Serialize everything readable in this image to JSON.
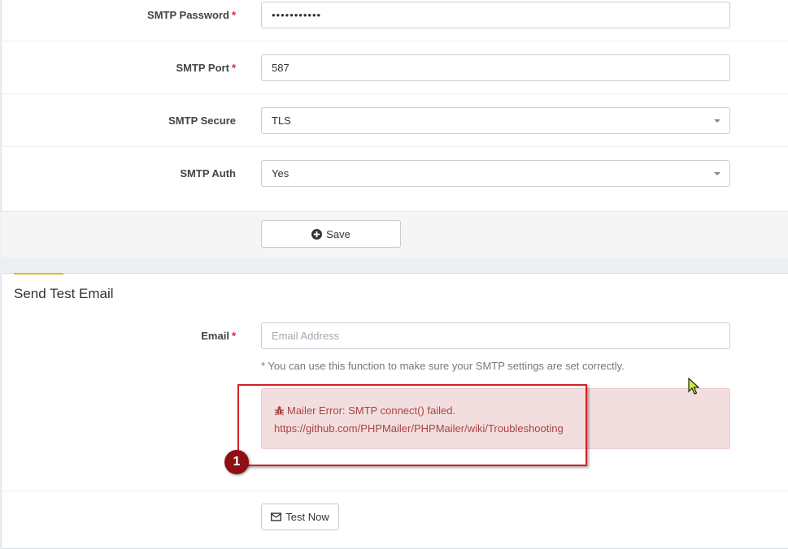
{
  "smtp_form": {
    "password": {
      "label": "SMTP Password",
      "required": "*",
      "value": "•••••••••••"
    },
    "port": {
      "label": "SMTP Port",
      "required": "*",
      "value": "587"
    },
    "secure": {
      "label": "SMTP Secure",
      "value": "TLS"
    },
    "auth": {
      "label": "SMTP Auth",
      "value": "Yes"
    },
    "save_label": "Save"
  },
  "test_email": {
    "title": "Send Test Email",
    "email": {
      "label": "Email",
      "required": "*",
      "placeholder": "Email Address"
    },
    "help_text": "* You can use this function to make sure your SMTP settings are set correctly.",
    "alert": {
      "line1": "Mailer Error: SMTP connect() failed.",
      "line2": "https://github.com/PHPMailer/PHPMailer/wiki/Troubleshooting"
    },
    "test_label": "Test Now"
  },
  "annotation": {
    "number": "1"
  },
  "colors": {
    "accent": "#f2b21b",
    "alert_bg": "#f2dede",
    "alert_text": "#a94442",
    "annotation": "#d32027"
  }
}
